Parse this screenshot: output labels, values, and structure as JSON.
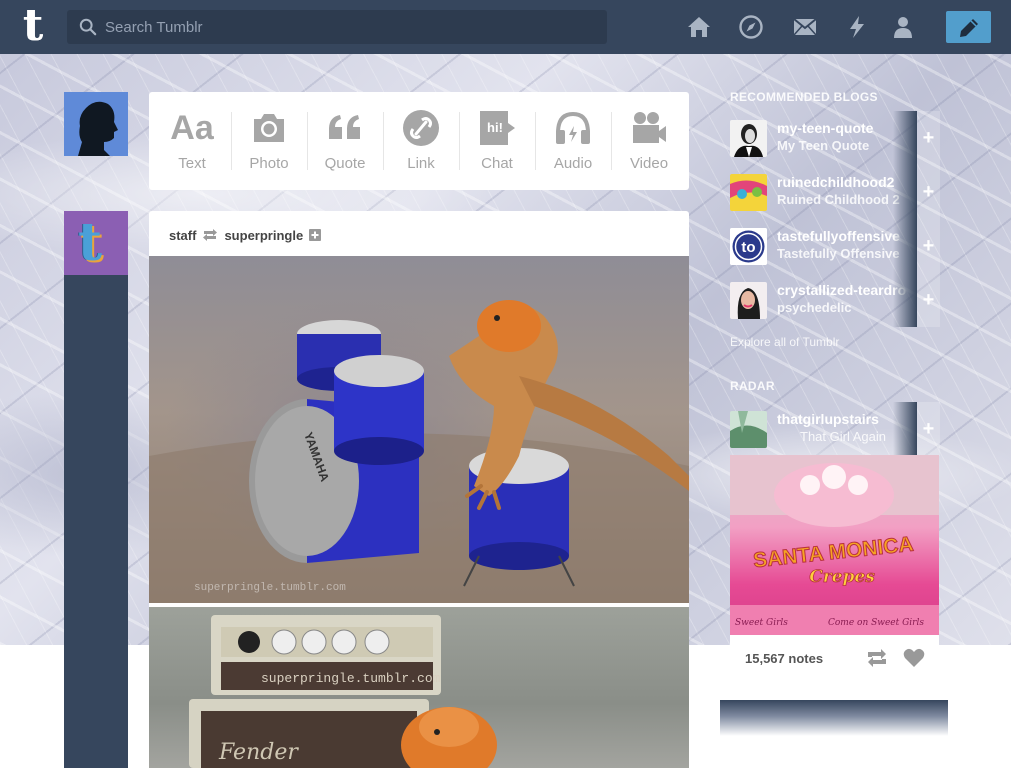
{
  "header": {
    "logo_letter": "t",
    "search_placeholder": "Search Tumblr",
    "nav_icons": [
      "home-icon",
      "explore-icon",
      "inbox-icon",
      "activity-icon",
      "account-icon"
    ],
    "compose_icon": "pencil-icon",
    "colors": {
      "bar": "#36465d",
      "compose": "#529ecc"
    }
  },
  "post_types": [
    {
      "label": "Text",
      "icon": "text-icon",
      "glyph": "Aa"
    },
    {
      "label": "Photo",
      "icon": "camera-icon"
    },
    {
      "label": "Quote",
      "icon": "quote-icon"
    },
    {
      "label": "Link",
      "icon": "link-icon"
    },
    {
      "label": "Chat",
      "icon": "chat-icon",
      "glyph": "hi!"
    },
    {
      "label": "Audio",
      "icon": "headphones-icon"
    },
    {
      "label": "Video",
      "icon": "video-camera-icon"
    }
  ],
  "post": {
    "author": "staff",
    "reblogged_from": "superpringle",
    "watermark": "superpringle.tumblr.com",
    "drum_brand": "YAMAHA",
    "amp_brand": "Fender"
  },
  "recommended": {
    "title": "RECOMMENDED BLOGS",
    "blogs": [
      {
        "name": "my-teen-quote",
        "title": "My Teen Quote"
      },
      {
        "name": "ruinedchildhood2",
        "title": "Ruined Childhood 2"
      },
      {
        "name": "tastefullyoffensive",
        "title": "Tastefully Offensive"
      },
      {
        "name": "crystallized-teardrop",
        "title": "psychedelic"
      }
    ],
    "avatar_text_to": "to",
    "explore_label": "Explore all of Tumblr"
  },
  "radar": {
    "title": "RADAR",
    "blog_name": "thatgirlupstairs",
    "blog_title": "That Girl Again",
    "sign_text": "SANTA MONICA",
    "sign_subtext": "Crepes",
    "awning_left": "Sweet Girls",
    "awning_right": "Come on Sweet Girls",
    "notes": "15,567 notes"
  }
}
